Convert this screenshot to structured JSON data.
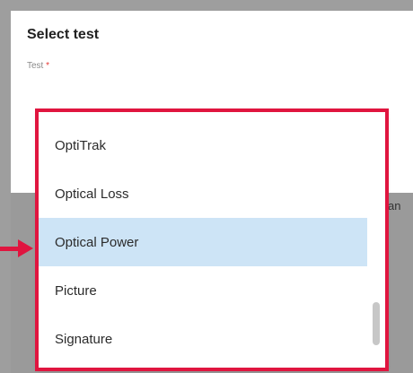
{
  "dialog": {
    "title": "Select test",
    "field_label": "Test",
    "required_mark": "*",
    "partial_text": "an"
  },
  "dropdown": {
    "options": [
      {
        "label": "OptiTrak",
        "selected": false
      },
      {
        "label": "Optical Loss",
        "selected": false
      },
      {
        "label": "Optical Power",
        "selected": true
      },
      {
        "label": "Picture",
        "selected": false
      },
      {
        "label": "Signature",
        "selected": false
      }
    ]
  },
  "annotation": {
    "highlight_color": "#e0153f",
    "selected_color": "#cde4f6"
  },
  "icons": {
    "pointer": "arrow-right-icon"
  }
}
